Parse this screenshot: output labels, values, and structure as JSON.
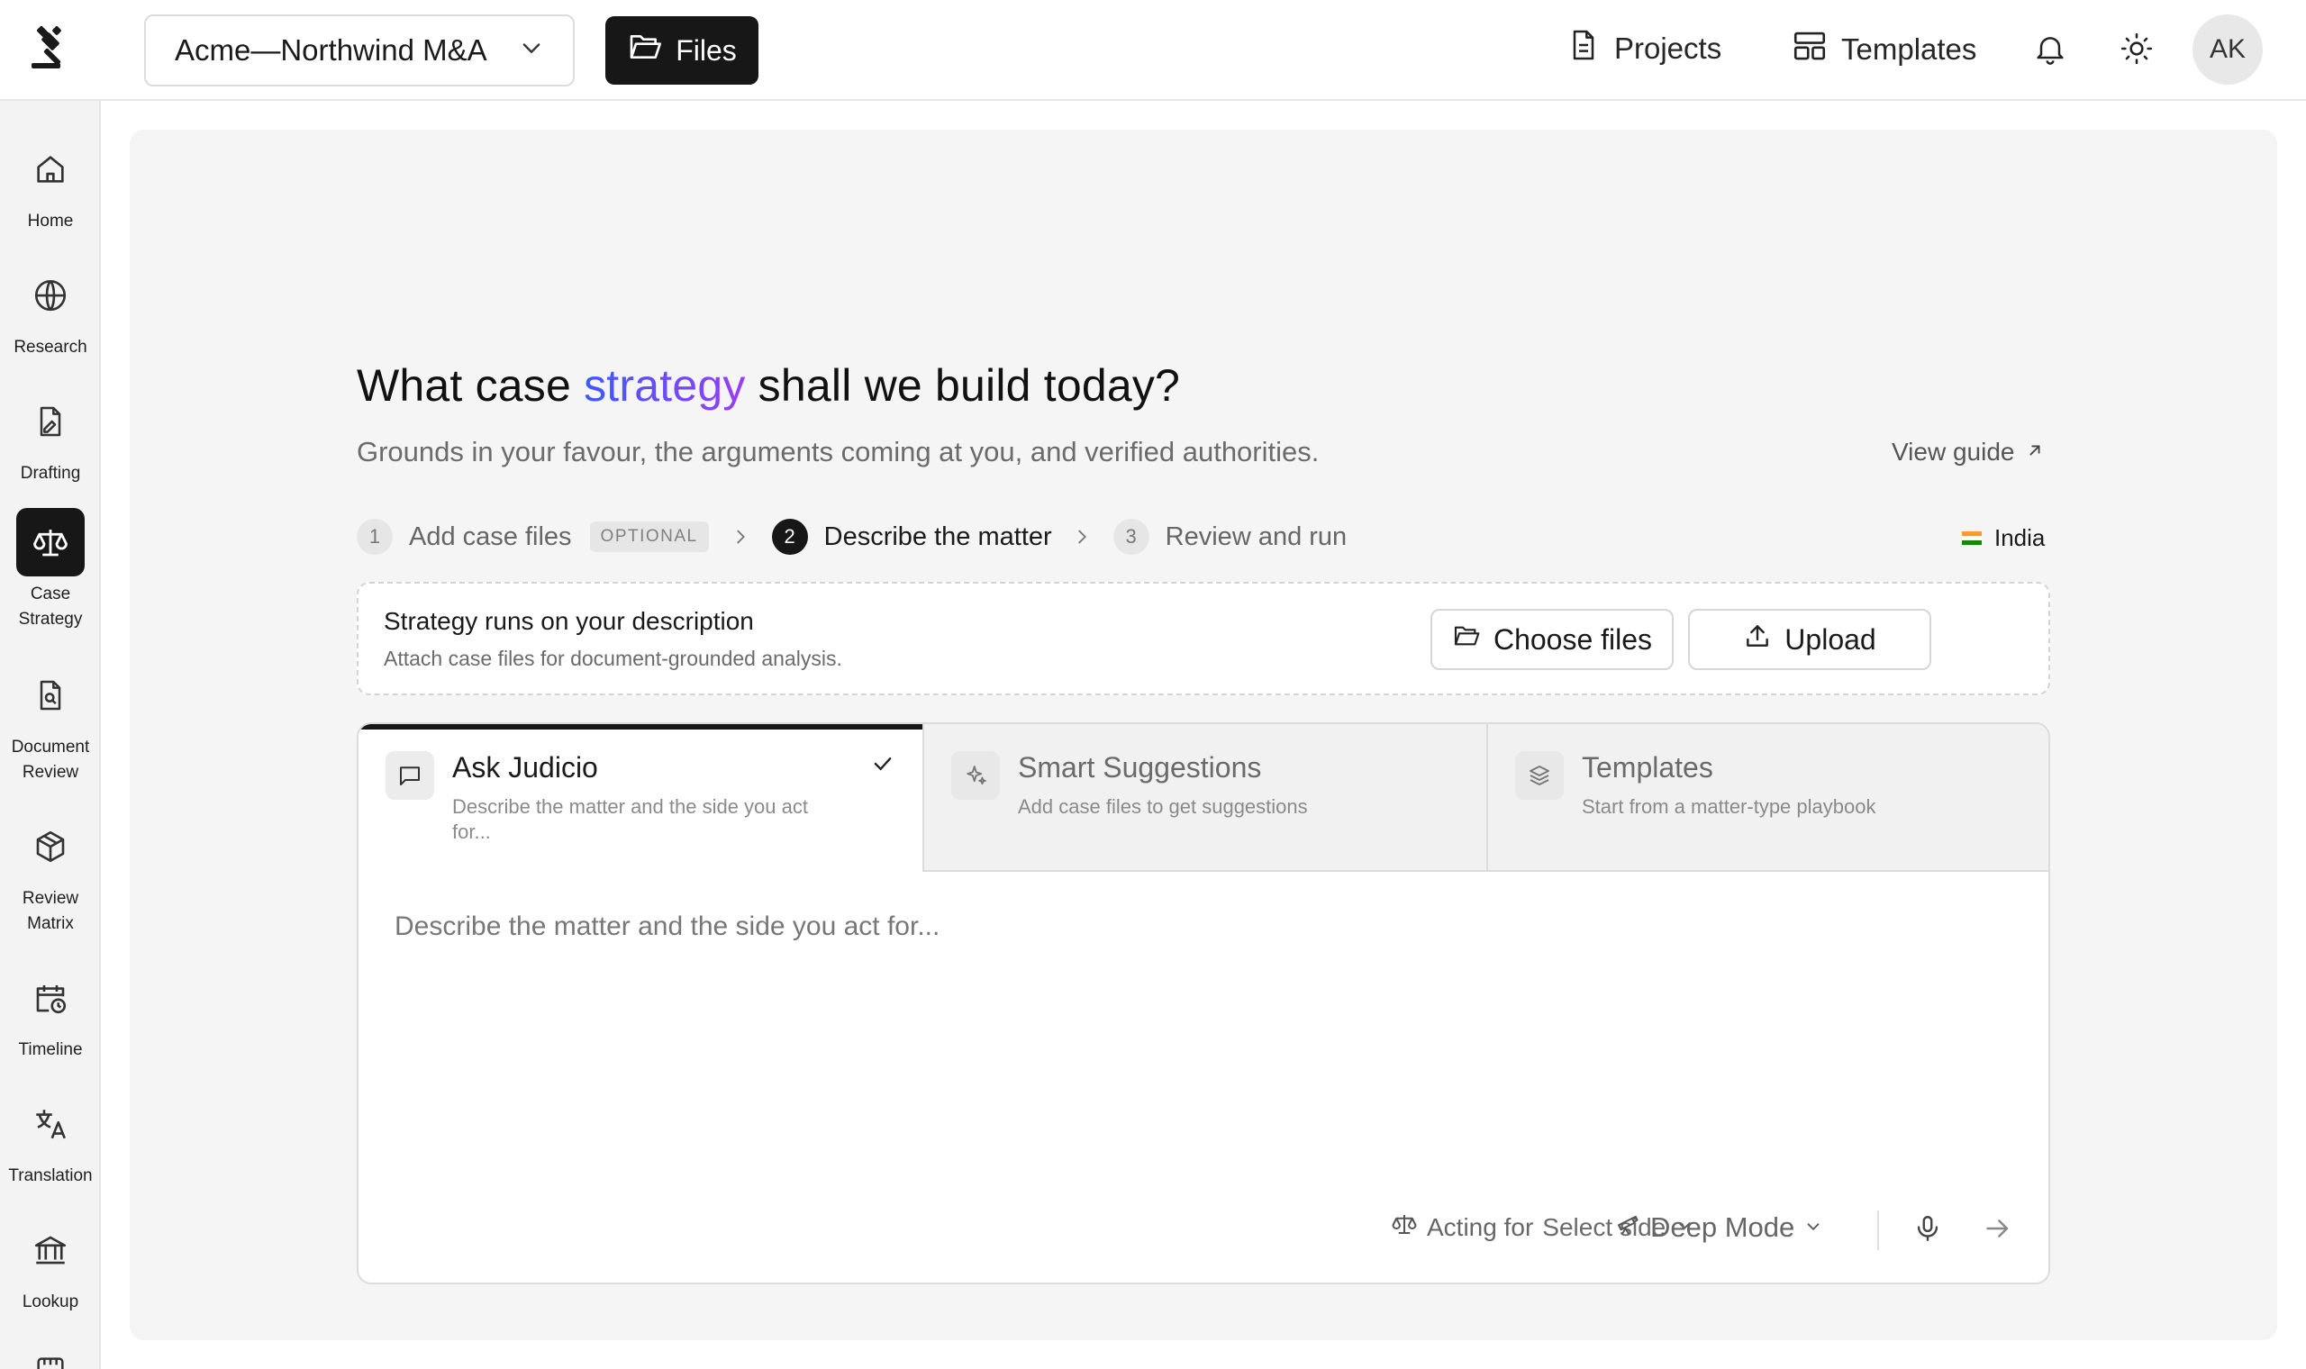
{
  "app": {
    "workspace_label": "Acme—Northwind M&A",
    "files_label": "Files",
    "projects_label": "Projects",
    "templates_label": "Templates",
    "avatar_initials": "AK"
  },
  "sidebar": {
    "items": [
      {
        "label": "Home",
        "icon": "home-icon"
      },
      {
        "label": "Research",
        "icon": "globe-icon"
      },
      {
        "label": "Drafting",
        "icon": "pen-document-icon"
      },
      {
        "label": "Case Strategy",
        "icon": "scales-icon",
        "active": true
      },
      {
        "label": "Document Review",
        "icon": "document-search-icon"
      },
      {
        "label": "Review Matrix",
        "icon": "cube-icon"
      },
      {
        "label": "Timeline",
        "icon": "calendar-clock-icon"
      },
      {
        "label": "Translation",
        "icon": "translate-icon"
      },
      {
        "label": "Lookup",
        "icon": "bank-icon"
      }
    ]
  },
  "main": {
    "headline_before": "What case ",
    "headline_accent": "strategy",
    "headline_after": " shall we build today?",
    "subline": "Grounds in your favour, the arguments coming at you, and verified authorities.",
    "view_guide": "View guide",
    "region": "India",
    "steps": [
      {
        "num": "1",
        "label": "Add case files",
        "tag": "OPTIONAL"
      },
      {
        "num": "2",
        "label": "Describe the matter",
        "active": true
      },
      {
        "num": "3",
        "label": "Review and run"
      }
    ],
    "attach": {
      "title": "Strategy runs on your description",
      "subtitle": "Attach case files for document-grounded analysis.",
      "choose_label": "Choose files",
      "upload_label": "Upload"
    },
    "tabs": [
      {
        "title": "Ask Judicio",
        "subtitle": "Describe the matter and the side you act for...",
        "icon": "chat-icon",
        "active": true
      },
      {
        "title": "Smart Suggestions",
        "subtitle": "Add case files to get suggestions",
        "icon": "sparkles-icon"
      },
      {
        "title": "Templates",
        "subtitle": "Start from a matter-type playbook",
        "icon": "layers-icon"
      }
    ],
    "prompt_placeholder": "Describe the matter and the side you act for...",
    "toolbar": {
      "acting_for_label": "Acting for",
      "side_value": "Select side",
      "mode_value": "Deep Mode"
    }
  },
  "colors": {
    "accent_gradient_start": "#3b5bff",
    "accent_gradient_end": "#9b3df5",
    "active_dark": "#171717",
    "panel_bg": "#f5f5f5"
  }
}
